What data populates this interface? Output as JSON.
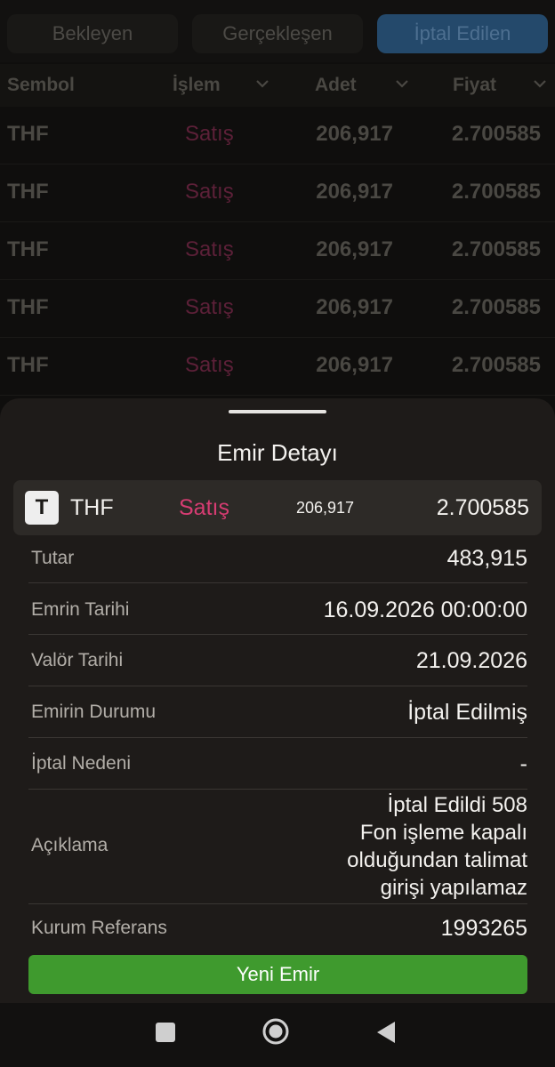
{
  "tabs": [
    "Bekleyen",
    "Gerçekleşen",
    "İptal Edilen"
  ],
  "active_tab": "İptal Edilen",
  "columns": {
    "symbol": "Sembol",
    "operation": "İşlem",
    "quantity": "Adet",
    "price": "Fiyat"
  },
  "orders": [
    {
      "symbol": "THF",
      "operation": "Satış",
      "quantity": "206,917",
      "price": "2.700585"
    },
    {
      "symbol": "THF",
      "operation": "Satış",
      "quantity": "206,917",
      "price": "2.700585"
    },
    {
      "symbol": "THF",
      "operation": "Satış",
      "quantity": "206,917",
      "price": "2.700585"
    },
    {
      "symbol": "THF",
      "operation": "Satış",
      "quantity": "206,917",
      "price": "2.700585"
    },
    {
      "symbol": "THF",
      "operation": "Satış",
      "quantity": "206,917",
      "price": "2.700585"
    }
  ],
  "detail": {
    "title": "Emir Detayı",
    "summary": {
      "logo_letter": "T",
      "symbol": "THF",
      "operation": "Satış",
      "quantity": "206,917",
      "price": "2.700585"
    },
    "fields": [
      {
        "label": "Tutar",
        "value": "483,915"
      },
      {
        "label": "Emrin Tarihi",
        "value": "16.09.2026 00:00:00"
      },
      {
        "label": "Valör Tarihi",
        "value": "21.09.2026"
      },
      {
        "label": "Emirin Durumu",
        "value": "İptal Edilmiş"
      },
      {
        "label": "İptal Nedeni",
        "value": "-"
      },
      {
        "label": "Açıklama",
        "value_lines": [
          "İptal Edildi 508",
          "Fon işleme kapalı",
          "olduğundan talimat",
          "girişi yapılamaz"
        ]
      },
      {
        "label": "Kurum Referans",
        "value": "1993265"
      }
    ],
    "new_order_button": "Yeni Emir"
  },
  "colors": {
    "sell": "#d63c72",
    "active_tab": "#24496b",
    "button": "#3f9a2e",
    "sheet_background": "#1e1b19"
  },
  "icons": {
    "sort": "chevron-down-icon",
    "nav": [
      "recent-apps-icon",
      "home-icon",
      "back-icon"
    ]
  }
}
